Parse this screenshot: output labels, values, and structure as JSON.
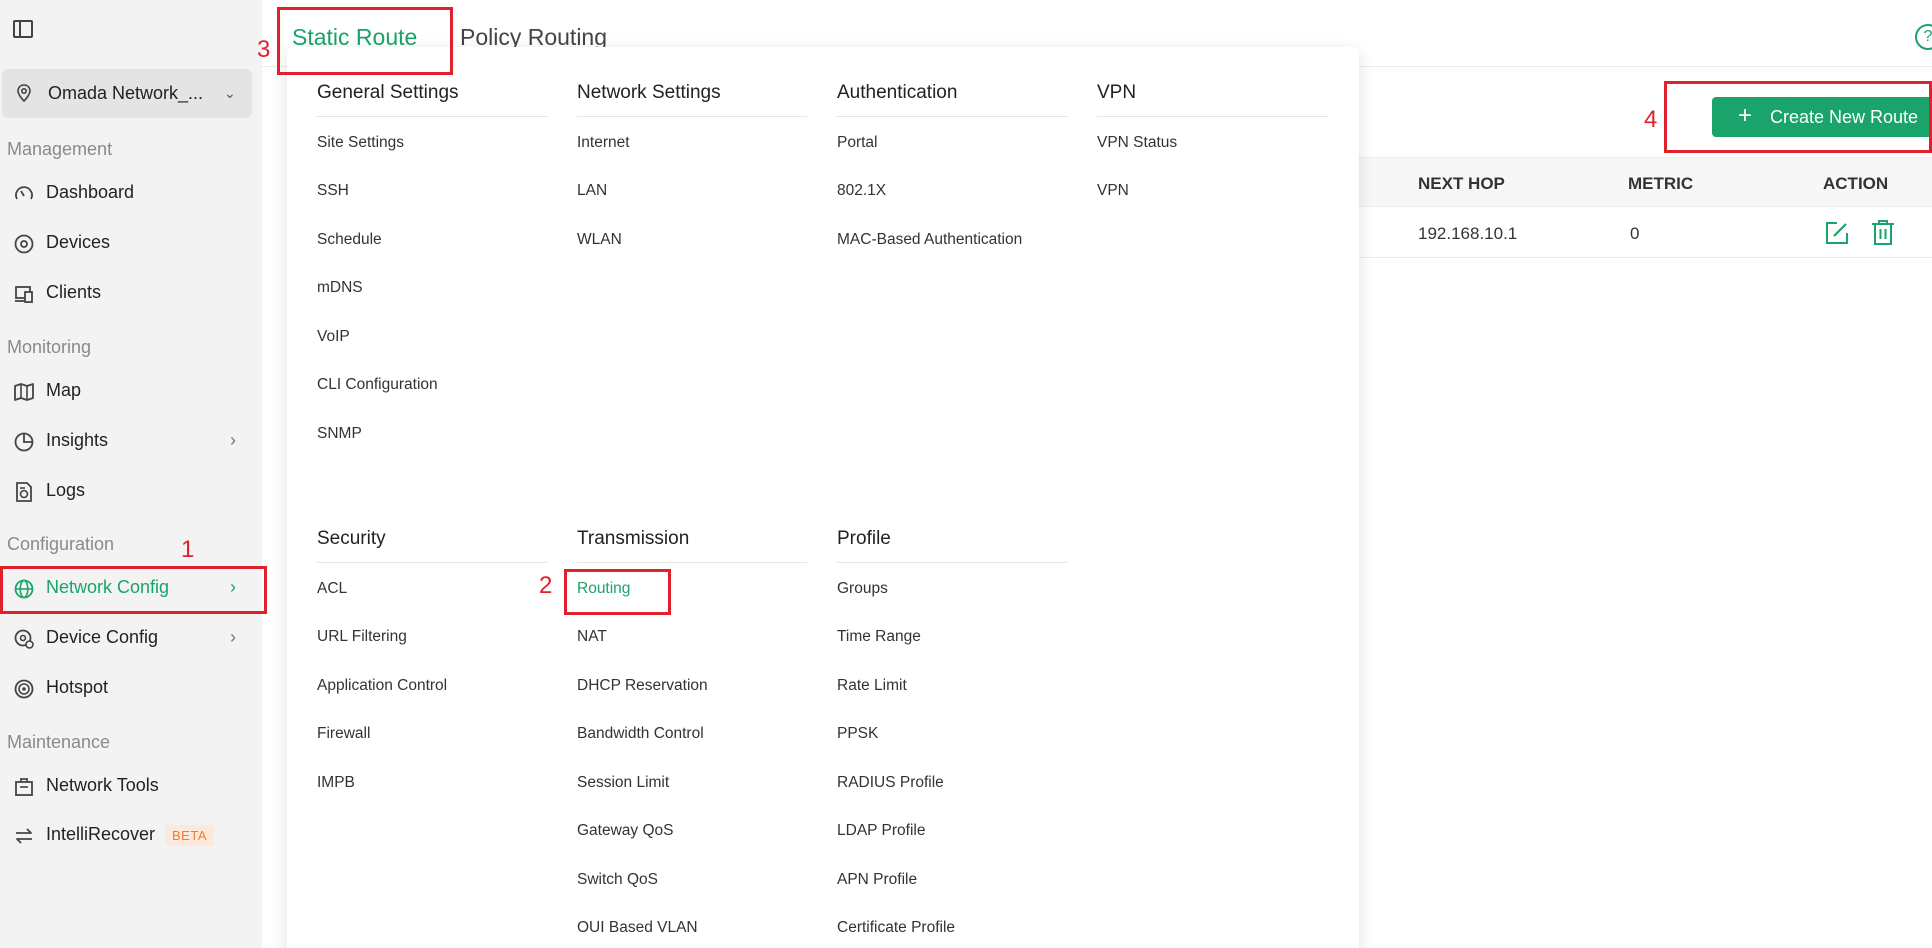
{
  "sidebar": {
    "site_name": "Omada Network_...",
    "sections": {
      "management": "Management",
      "monitoring": "Monitoring",
      "configuration": "Configuration",
      "maintenance": "Maintenance"
    },
    "items": {
      "dashboard": "Dashboard",
      "devices": "Devices",
      "clients": "Clients",
      "map": "Map",
      "insights": "Insights",
      "logs": "Logs",
      "network_config": "Network Config",
      "device_config": "Device Config",
      "hotspot": "Hotspot",
      "network_tools": "Network Tools",
      "intellirecover": "IntelliRecover"
    },
    "beta_badge": "BETA"
  },
  "tabs": {
    "static_route": "Static Route",
    "policy_routing": "Policy Routing"
  },
  "toolbar": {
    "create_label": "Create New Route",
    "create_icon": "+"
  },
  "table": {
    "headers": [
      "NEXT HOP",
      "METRIC",
      "ACTION"
    ],
    "row": {
      "next_hop": "192.168.10.1",
      "metric": "0"
    }
  },
  "menu": {
    "general": {
      "title": "General Settings",
      "items": [
        "Site Settings",
        "SSH",
        "Schedule",
        "mDNS",
        "VoIP",
        "CLI Configuration",
        "SNMP"
      ]
    },
    "network": {
      "title": "Network Settings",
      "items": [
        "Internet",
        "LAN",
        "WLAN"
      ]
    },
    "authentication": {
      "title": "Authentication",
      "items": [
        "Portal",
        "802.1X",
        "MAC-Based Authentication"
      ]
    },
    "vpn": {
      "title": "VPN",
      "items": [
        "VPN Status",
        "VPN"
      ]
    },
    "security": {
      "title": "Security",
      "items": [
        "ACL",
        "URL Filtering",
        "Application Control",
        "Firewall",
        "IMPB"
      ]
    },
    "transmission": {
      "title": "Transmission",
      "items": [
        "Routing",
        "NAT",
        "DHCP Reservation",
        "Bandwidth Control",
        "Session Limit",
        "Gateway QoS",
        "Switch QoS",
        "OUI Based VLAN"
      ]
    },
    "profile": {
      "title": "Profile",
      "items": [
        "Groups",
        "Time Range",
        "Rate Limit",
        "PPSK",
        "RADIUS Profile",
        "LDAP Profile",
        "APN Profile",
        "Certificate Profile"
      ]
    }
  },
  "annotations": [
    "1",
    "2",
    "3",
    "4"
  ],
  "colors": {
    "accent": "#1aa36a",
    "annotation": "#e0202a",
    "sidebar_bg": "#f3f3f3"
  }
}
